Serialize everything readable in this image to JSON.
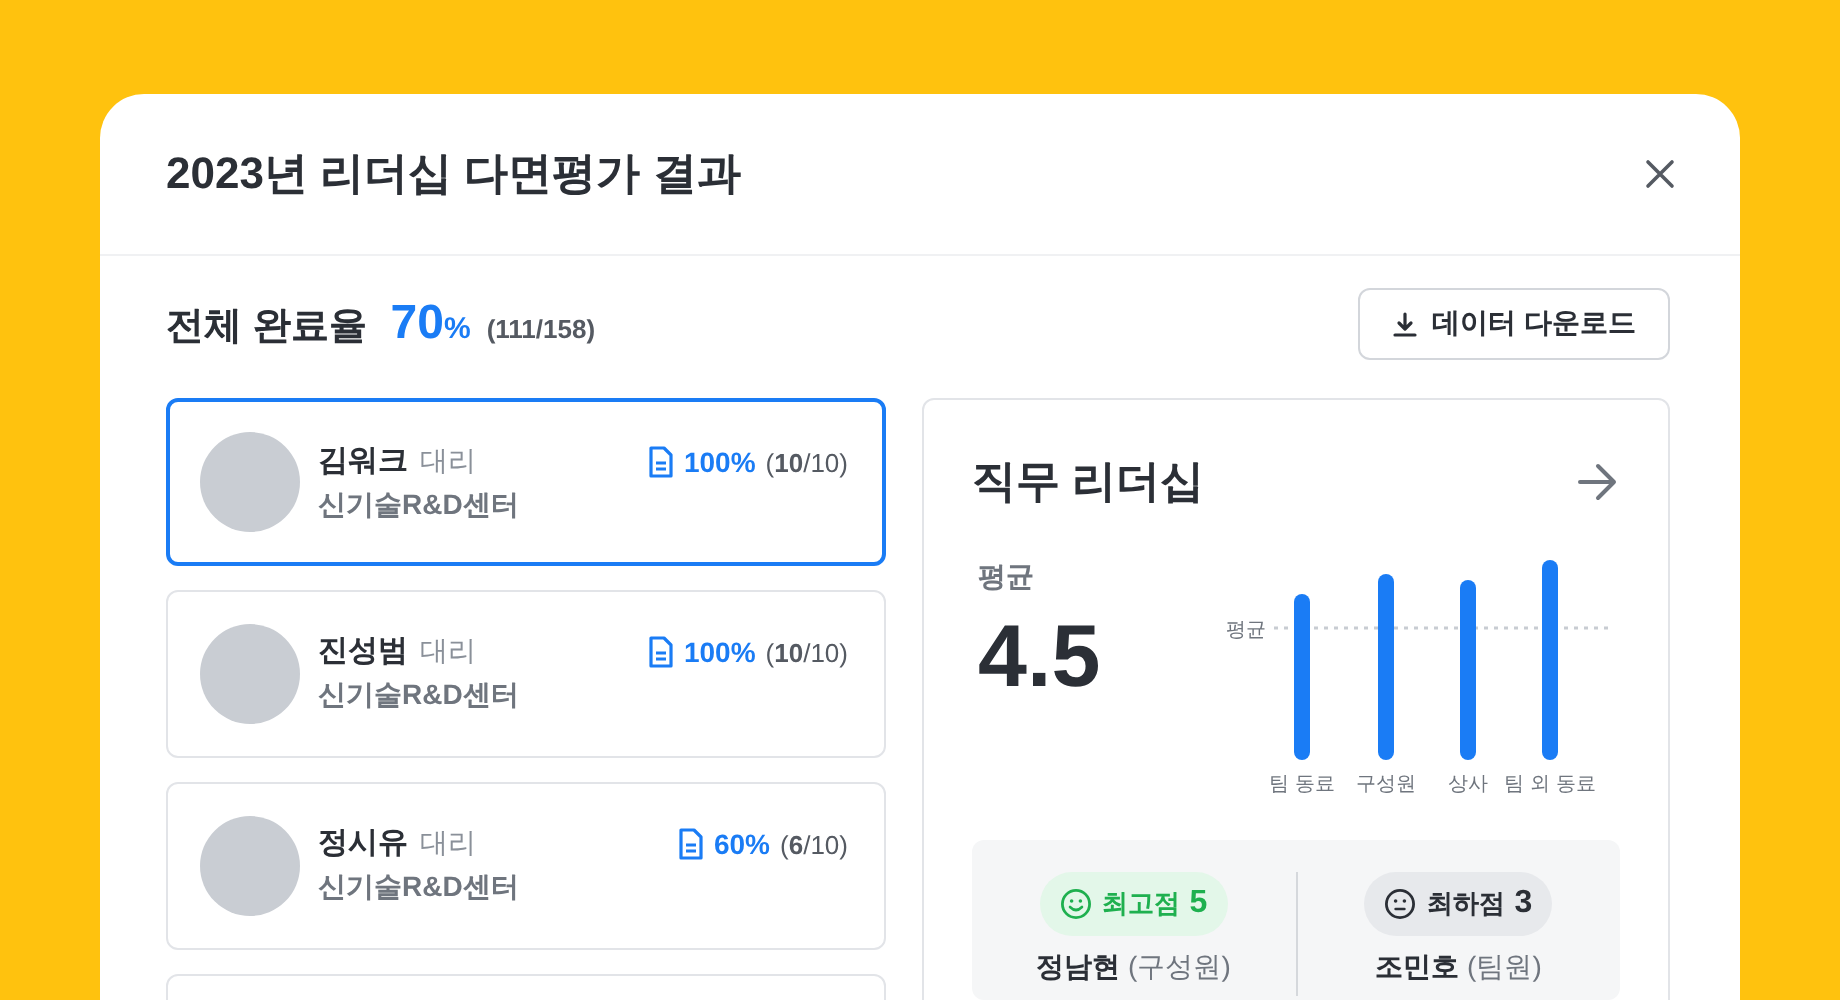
{
  "window": {
    "title": "2023년 리더십 다면평가 결과"
  },
  "summary": {
    "label": "전체 완료율",
    "rate": "70",
    "unit": "%",
    "count": "(111/158)"
  },
  "download_button": "데이터 다운로드",
  "people": [
    {
      "name": "김워크",
      "position": "대리",
      "department": "신기술R&D센터",
      "rate": "100%",
      "count": "(**10**/10)",
      "selected": true
    },
    {
      "name": "진성범",
      "position": "대리",
      "department": "신기술R&D센터",
      "rate": "100%",
      "count": "(**10**/10)",
      "selected": false
    },
    {
      "name": "정시유",
      "position": "대리",
      "department": "신기술R&D센터",
      "rate": "60%",
      "count": "(**6**/10)",
      "selected": false
    }
  ],
  "panel": {
    "title": "직무 리더십",
    "average_label": "평균",
    "average": "4.5",
    "chart": {
      "reference_label": "평균",
      "categories": [
        "팀 동료",
        "구성원",
        "상사",
        "팀 외 동료"
      ]
    },
    "extremes": [
      {
        "kind": "high",
        "label": "최고점",
        "score": "5",
        "name": "정남현",
        "role": "(구성원)"
      },
      {
        "kind": "low",
        "label": "최하점",
        "score": "3",
        "name": "조민호",
        "role": "(팀원)"
      }
    ]
  }
}
